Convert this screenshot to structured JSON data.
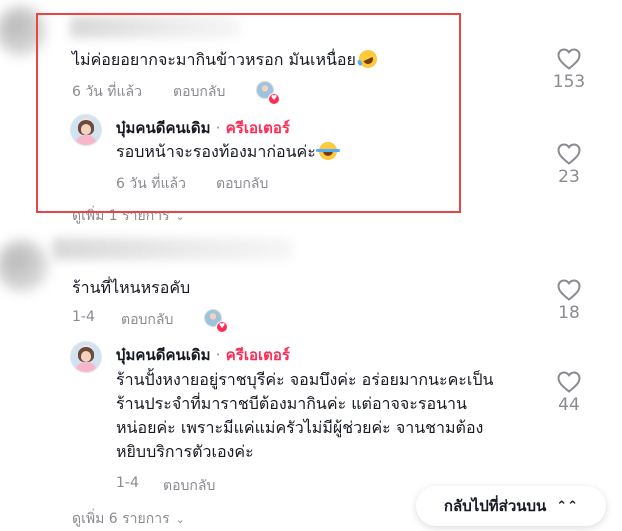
{
  "comments": [
    {
      "text": "ไม่ค่อยอยากจะมากินข้าวหรอก มันเหนื่อย",
      "emoji": "rolling-on-floor-laughing-emoji",
      "time": "6 วัน ที่แล้ว",
      "reply_label": "ตอบกลับ",
      "likes": "153",
      "reply": {
        "username": "บุ๋มคนดีคนเดิม",
        "separator": "·",
        "role": "ครีเอเตอร์",
        "text": "รอบหน้าจะรองท้องมาก่อนค่ะ",
        "emoji": "face-with-tears-of-joy-emoji",
        "time": "6 วัน ที่แล้ว",
        "reply_label": "ตอบกลับ",
        "likes": "23"
      },
      "view_more": "ดูเพิ่ม 1 รายการ"
    },
    {
      "text": "ร้านที่ไหนหรอคับ",
      "time": "1-4",
      "reply_label": "ตอบกลับ",
      "likes": "18",
      "reply": {
        "username": "บุ๋มคนดีคนเดิม",
        "separator": "·",
        "role": "ครีเอเตอร์",
        "lines": [
          "ร้านปั้งหงายอยู่ราชบุรีค่ะ จอมบึงค่ะ อร่อยมากนะคะเป็น",
          "ร้านประจำที่มาราชบีต้องมากินค่ะ แต่อาจจะรอนาน",
          "หน่อยค่ะ เพราะมีแค่แม่ครัวไม่มีผู้ช่วยค่ะ จานชามต้อง",
          "หยิบบริการตัวเองค่ะ"
        ],
        "time": "1-4",
        "reply_label": "ตอบกลับ",
        "likes": "44"
      },
      "view_more": "ดูเพิ่ม 6 รายการ"
    }
  ],
  "back_to_top": "กลับไปที่ส่วนบน",
  "colors": {
    "creator": "#fe2c55",
    "meta": "#8a8b91",
    "highlight_border": "#e94545"
  }
}
